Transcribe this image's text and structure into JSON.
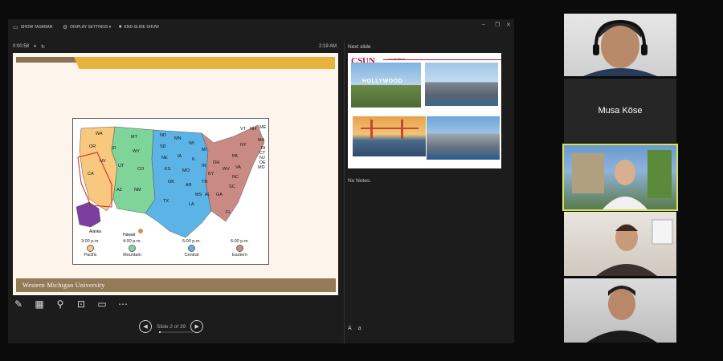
{
  "toolbar": {
    "show_taskbar": "SHOW TASKBAR",
    "display_settings": "DISPLAY SETTINGS ▾",
    "end_slide_show": "END SLIDE SHOW"
  },
  "timer": {
    "elapsed": "0:00:58"
  },
  "clock": "2:19 AM",
  "slide": {
    "footer": "Western Michigan University",
    "map": {
      "states": {
        "pacific": [
          "WA",
          "OR",
          "CA",
          "NV"
        ],
        "mountain": [
          "ID",
          "MT",
          "WY",
          "UT",
          "CO",
          "AZ",
          "NM"
        ],
        "central": [
          "ND",
          "SD",
          "NE",
          "KS",
          "OK",
          "TX",
          "MN",
          "IA",
          "MO",
          "AR",
          "LA",
          "WI",
          "IL",
          "MS",
          "AL",
          "TN"
        ],
        "eastern": [
          "MI",
          "IN",
          "OH",
          "KY",
          "GA",
          "FL",
          "SC",
          "NC",
          "VA",
          "WV",
          "PA",
          "NY",
          "VT",
          "NH",
          "ME",
          "MA",
          "RI",
          "CT",
          "NJ",
          "DE",
          "MD"
        ]
      },
      "alaska": "Alaska",
      "hawaii": "Hawaii",
      "zones": [
        {
          "time": "3:00 p.m.",
          "name": "Pacific",
          "color": "#f7c87e"
        },
        {
          "time": "4:00 p.m.",
          "name": "Mountain",
          "color": "#7fd49a"
        },
        {
          "time": "5:00 p.m.",
          "name": "Central",
          "color": "#5bb3e6"
        },
        {
          "time": "6:00 p.m.",
          "name": "Eastern",
          "color": "#c98a83"
        }
      ]
    }
  },
  "controls": {
    "icons": [
      "pen-icon",
      "slides-grid-icon",
      "zoom-icon",
      "pointer-icon",
      "subtitles-icon",
      "more-icon"
    ],
    "slide_counter": "Slide 2 of 39",
    "progress": 0.05
  },
  "next_slide": {
    "label": "Next slide",
    "csun": "CSUN",
    "california": "CALIFORNIA",
    "hollywood": "HOLLYWOOD"
  },
  "notes": "No Notes.",
  "participants": {
    "name_tile": "Musa Köse"
  },
  "colors": {
    "active_border": "#d6e25a"
  }
}
